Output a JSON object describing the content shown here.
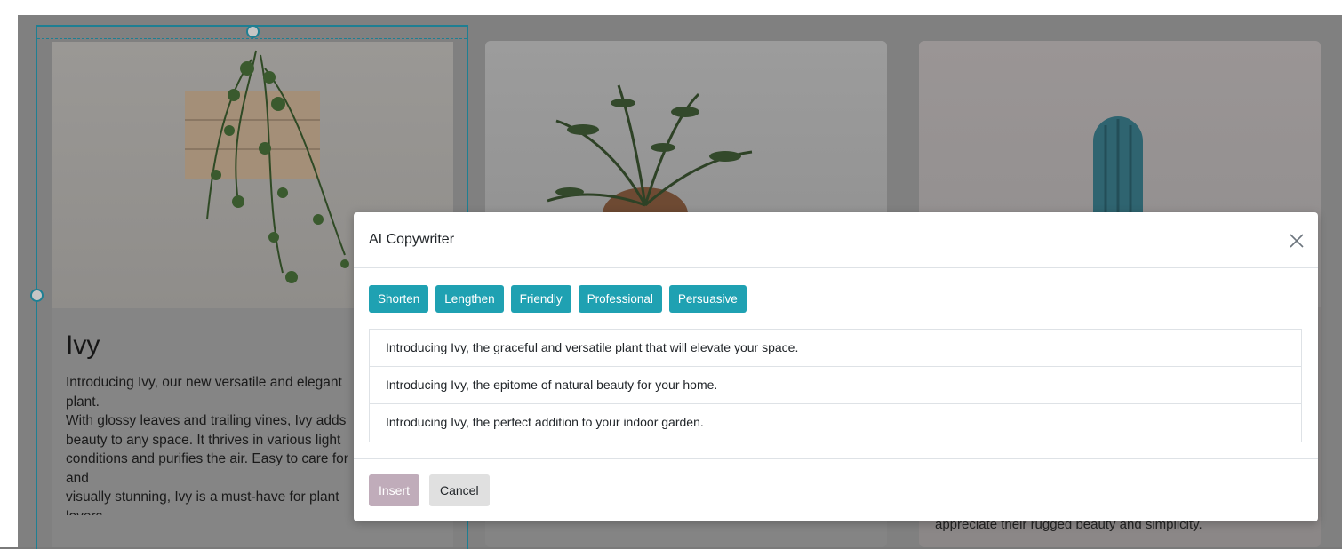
{
  "cards": [
    {
      "title": "Ivy",
      "description": "Introducing Ivy, our new versatile and elegant plant.\nWith glossy leaves and trailing vines, Ivy adds\nbeauty to any space. It thrives in various light\nconditions and purifies the air. Easy to care for and\nvisually stunning, Ivy is a must-have for plant lovers."
    },
    {
      "title": "",
      "description": ""
    },
    {
      "title": "",
      "description": "",
      "visible_text": "appreciate their rugged beauty and simplicity."
    }
  ],
  "modal": {
    "title": "AI Copywriter",
    "close_icon": "close-icon",
    "tone_buttons": [
      "Shorten",
      "Lengthen",
      "Friendly",
      "Professional",
      "Persuasive"
    ],
    "suggestions": [
      "Introducing Ivy, the graceful and versatile plant that will elevate your space.",
      "Introducing Ivy, the epitome of natural beauty for your home.",
      "Introducing Ivy, the perfect addition to your indoor garden."
    ],
    "insert_label": "Insert",
    "cancel_label": "Cancel"
  },
  "colors": {
    "accent": "#1fa1b2",
    "selection": "#1e7f93",
    "insert_disabled": "#c0acba",
    "backdrop": "#808080"
  }
}
